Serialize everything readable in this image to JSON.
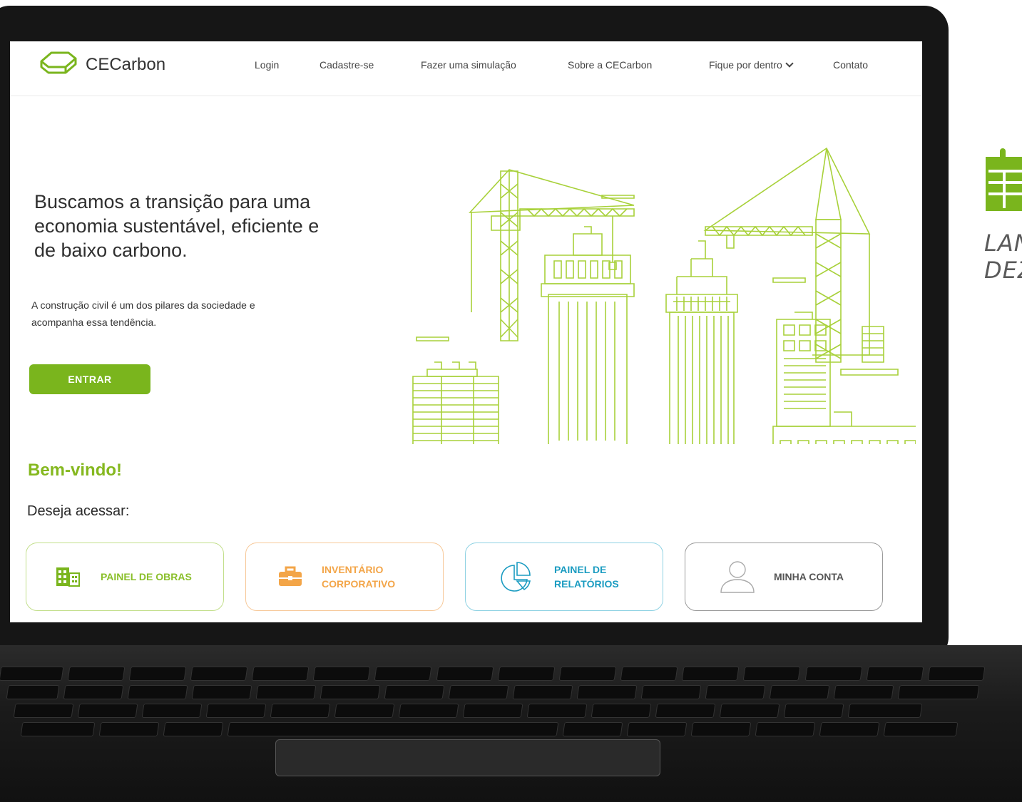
{
  "brand": {
    "name": "CECarbon",
    "accent": "#7ab51d"
  },
  "nav": {
    "items": [
      {
        "label": "Login"
      },
      {
        "label": "Cadastre-se"
      },
      {
        "label": "Fazer uma simulação"
      },
      {
        "label": "Sobre a CECarbon"
      },
      {
        "label": "Fique por dentro"
      },
      {
        "label": "Contato"
      }
    ]
  },
  "hero": {
    "title": "Buscamos a transição para uma economia sustentável, eficiente e de baixo carbono.",
    "subtitle": "A construção civil é um dos pilares da sociedade e acompanha essa tendência.",
    "cta_label": "ENTRAR"
  },
  "welcome": {
    "title": "Bem-vindo!",
    "prompt": "Deseja acessar:"
  },
  "cards": [
    {
      "label": "PAINEL DE OBRAS",
      "icon": "building-icon",
      "color": "#8abf2a"
    },
    {
      "label": "INVENTÁRIO\nCORPORATIVO",
      "icon": "briefcase-icon",
      "color": "#f3a548"
    },
    {
      "label": "PAINEL DE\nRELATÓRIOS",
      "icon": "pie-chart-icon",
      "color": "#1b9cc1"
    },
    {
      "label": "MINHA CONTA",
      "icon": "user-icon",
      "color": "#555555"
    }
  ],
  "promo": {
    "text": "LAN\nDEZ",
    "icon": "calendar-icon",
    "color": "#7ab51d"
  }
}
